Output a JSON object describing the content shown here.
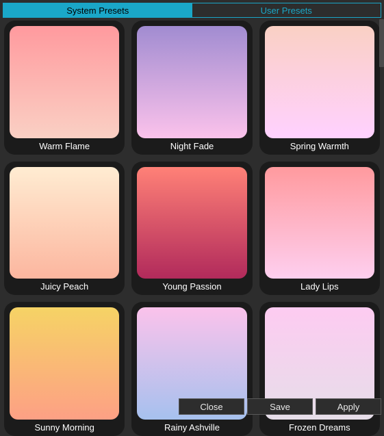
{
  "tabs": {
    "system": "System Presets",
    "user": "User Presets",
    "active": "system"
  },
  "presets": [
    {
      "name": "Warm Flame",
      "gradient": [
        "#ff9a9e",
        "#fad0c4"
      ]
    },
    {
      "name": "Night Fade",
      "gradient": [
        "#a18cd1",
        "#fbc2eb"
      ]
    },
    {
      "name": "Spring Warmth",
      "gradient": [
        "#fad0c4",
        "#ffd1ff"
      ]
    },
    {
      "name": "Juicy Peach",
      "gradient": [
        "#ffecd2",
        "#fcb69f"
      ]
    },
    {
      "name": "Young Passion",
      "gradient": [
        "#ff8177",
        "#b12a5b"
      ]
    },
    {
      "name": "Lady Lips",
      "gradient": [
        "#ff9a9e",
        "#fecfef"
      ]
    },
    {
      "name": "Sunny Morning",
      "gradient": [
        "#f6d365",
        "#fda085"
      ]
    },
    {
      "name": "Rainy Ashville",
      "gradient": [
        "#fbc2eb",
        "#a6c1ee"
      ]
    },
    {
      "name": "Frozen Dreams",
      "gradient": [
        "#fdcbf1",
        "#e6dee9"
      ]
    }
  ],
  "buttons": {
    "close": "Close",
    "save": "Save",
    "apply": "Apply"
  }
}
